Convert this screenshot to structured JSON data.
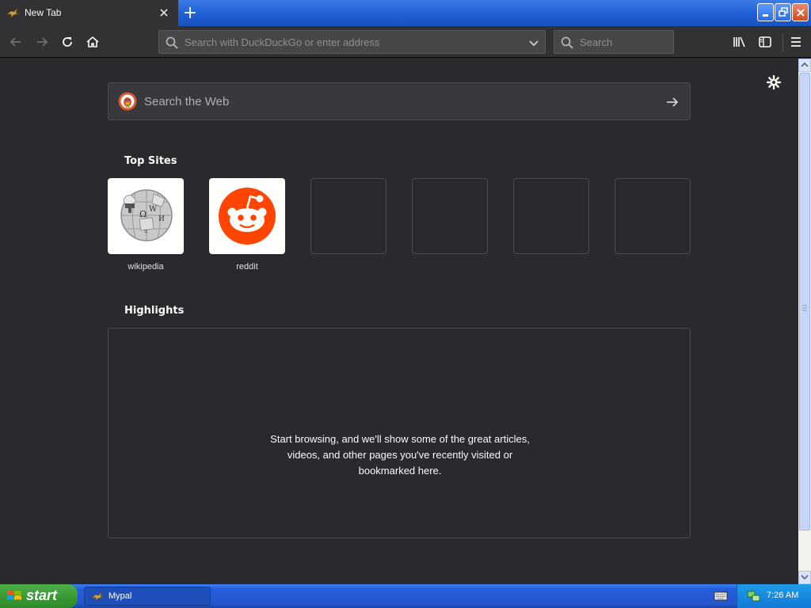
{
  "browser": {
    "tab": {
      "title": "New Tab"
    },
    "urlbar": {
      "placeholder": "Search with DuckDuckGo or enter address"
    },
    "searchbar": {
      "placeholder": "Search"
    }
  },
  "newtab": {
    "web_search_label": "Search the Web",
    "top_sites_title": "Top Sites",
    "top_sites": [
      {
        "label": "wikipedia"
      },
      {
        "label": "reddit"
      }
    ],
    "highlights_title": "Highlights",
    "highlights_message": [
      "Start browsing, and we'll show some of the great articles,",
      "videos, and other pages you've recently visited or",
      "bookmarked here."
    ]
  },
  "taskbar": {
    "start_label": "start",
    "task_item": "Mypal",
    "clock": "7:26 AM"
  },
  "colors": {
    "background": "#2a2a2e",
    "toolbar": "#323234",
    "reddit": "#ff4500",
    "xp_blue": "#245edb",
    "xp_green": "#3a9a35"
  },
  "icons": {
    "tab_favicon": "mypal-bird-icon",
    "new_tab": "plus-icon",
    "back": "arrow-left-icon",
    "forward": "arrow-right-icon",
    "reload": "reload-icon",
    "home": "home-icon",
    "library": "library-icon",
    "sidebar": "sidebar-icon",
    "menu": "hamburger-menu-icon",
    "settings": "gear-icon"
  }
}
